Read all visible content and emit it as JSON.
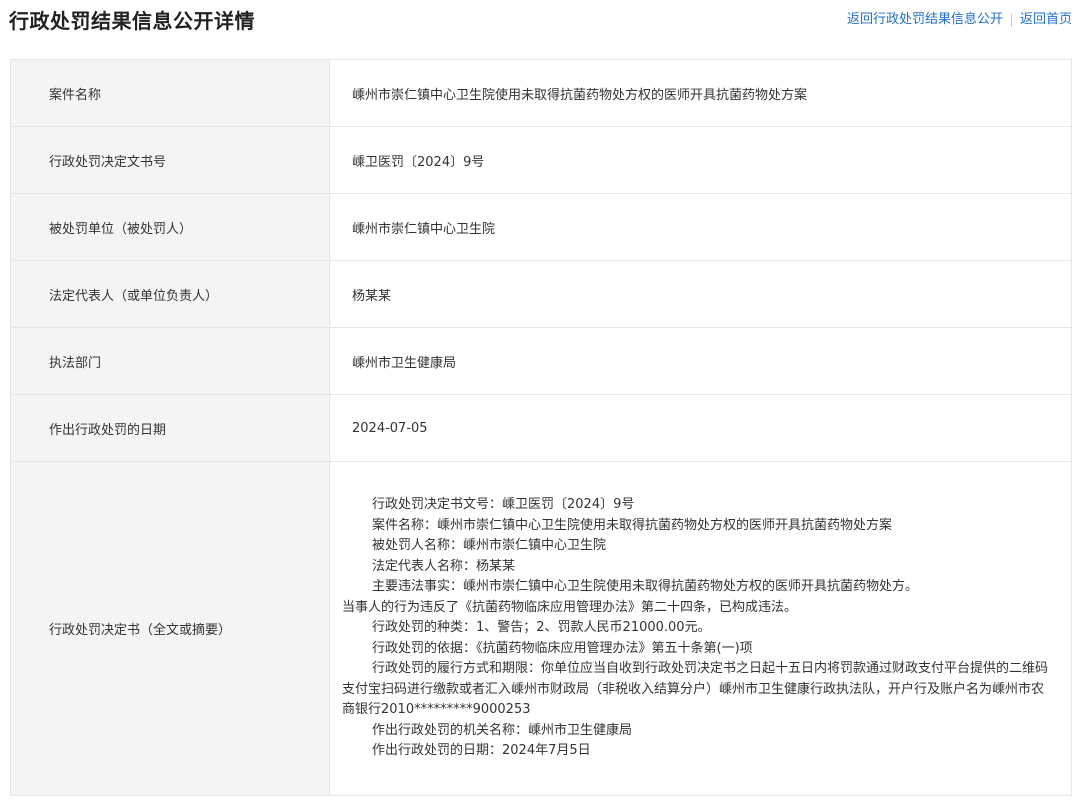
{
  "header": {
    "title": "行政处罚结果信息公开详情",
    "links": {
      "back_list": "返回行政处罚结果信息公开",
      "home": "返回首页"
    }
  },
  "rows": [
    {
      "label": "案件名称",
      "value": "嵊州市崇仁镇中心卫生院使用未取得抗菌药物处方权的医师开具抗菌药物处方案"
    },
    {
      "label": "行政处罚决定文书号",
      "value": "嵊卫医罚〔2024〕9号"
    },
    {
      "label": "被处罚单位（被处罚人）",
      "value": "嵊州市崇仁镇中心卫生院"
    },
    {
      "label": "法定代表人（或单位负责人）",
      "value": "杨某某"
    },
    {
      "label": "执法部门",
      "value": "嵊州市卫生健康局"
    },
    {
      "label": "作出行政处罚的日期",
      "value": "2024-07-05"
    }
  ],
  "decision": {
    "label": "行政处罚决定书（全文或摘要）",
    "lines": [
      "行政处罚决定书文号：嵊卫医罚〔2024〕9号",
      "案件名称：嵊州市崇仁镇中心卫生院使用未取得抗菌药物处方权的医师开具抗菌药物处方案",
      "被处罚人名称：嵊州市崇仁镇中心卫生院",
      "法定代表人名称：杨某某",
      "主要违法事实：嵊州市崇仁镇中心卫生院使用未取得抗菌药物处方权的医师开具抗菌药物处方。",
      "当事人的行为违反了《抗菌药物临床应用管理办法》第二十四条，已构成违法。",
      "行政处罚的种类：1、警告；2、罚款人民币21000.00元。",
      "行政处罚的依据：《抗菌药物临床应用管理办法》第五十条第(一)项",
      "行政处罚的履行方式和期限：你单位应当自收到行政处罚决定书之日起十五日内将罚款通过财政支付平台提供的二维码支付宝扫码进行缴款或者汇入嵊州市财政局（非税收入结算分户）嵊州市卫生健康行政执法队，开户行及账户名为嵊州市农商银行2010*********9000253",
      "作出行政处罚的机关名称：嵊州市卫生健康局",
      "作出行政处罚的日期：2024年7月5日"
    ]
  }
}
